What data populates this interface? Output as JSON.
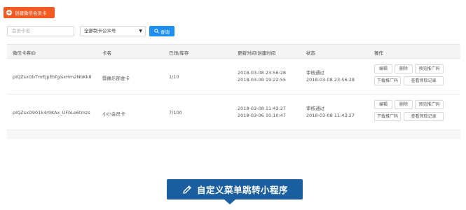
{
  "toolbar": {
    "create_label": "创建微信会员卡",
    "search_placeholder": "会员卡名",
    "account_select": "全部制卡公众号",
    "query_label": "查询"
  },
  "table": {
    "headers": [
      "微信卡券ID",
      "卡名",
      "已领/库存",
      "更新时间/创建时间",
      "状态",
      "操作"
    ],
    "rows": [
      {
        "id": "pIQZsxGbTmEJpEbfgisxHm2NbKk8",
        "name": "暨痛乐部金卡",
        "stock": "1/10",
        "updated": "2018-03-08 23:56:28",
        "created": "2018-03-08 19:22:55",
        "status": "审核通过",
        "status_time": "2018-03-08 23:56:28",
        "ops": [
          "编辑",
          "删除",
          "预览推广码",
          "下载推广码",
          "查看领取记录"
        ]
      },
      {
        "id": "pIQZsxD901k4r9KAx_UFbLe6tmzs",
        "name": "小小会员卡",
        "stock": "7/100",
        "updated": "2018-03-08 11:43:27",
        "created": "2018-03-06 10:10:47",
        "status": "审核通过",
        "status_time": "2018-03-08 11:43:27",
        "ops": [
          "编辑",
          "删除",
          "预览推广码",
          "下载推广码",
          "查看领取记录"
        ]
      }
    ]
  },
  "banner": {
    "text": "自定义菜单跳转小程序",
    "icon": "pencil-icon"
  },
  "colors": {
    "create_button": "#f35a21",
    "query_button": "#1e8ff0",
    "banner": "#1c5fa0"
  }
}
